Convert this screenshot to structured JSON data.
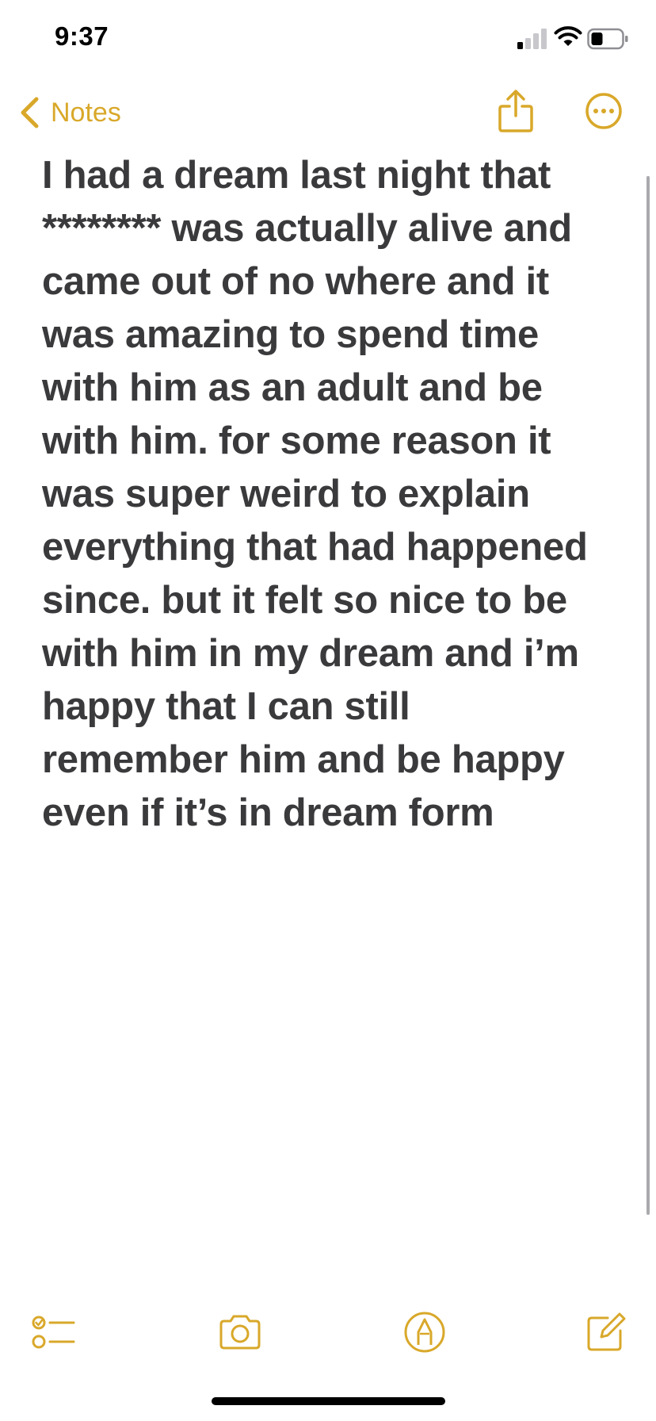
{
  "status_bar": {
    "time": "9:37"
  },
  "nav": {
    "back_label": "Notes",
    "accent_color": "#D9A82A"
  },
  "note": {
    "text": "I had a dream last night that\n******** was actually alive and\ncame out of no where and it\nwas amazing to spend time\nwith him as an adult and be\nwith him. for some reason it\nwas super weird to explain\neverything that had happened\nsince. but it felt so nice to be\nwith him in my dream and i’m\nhappy that I can still\nremember him and be happy\neven if it’s in dream form"
  },
  "icons": {
    "back": "chevron-left-icon",
    "share": "share-icon",
    "more": "ellipsis-circle-icon",
    "checklist": "checklist-icon",
    "camera": "camera-icon",
    "markup": "markup-pen-icon",
    "compose": "compose-icon"
  }
}
